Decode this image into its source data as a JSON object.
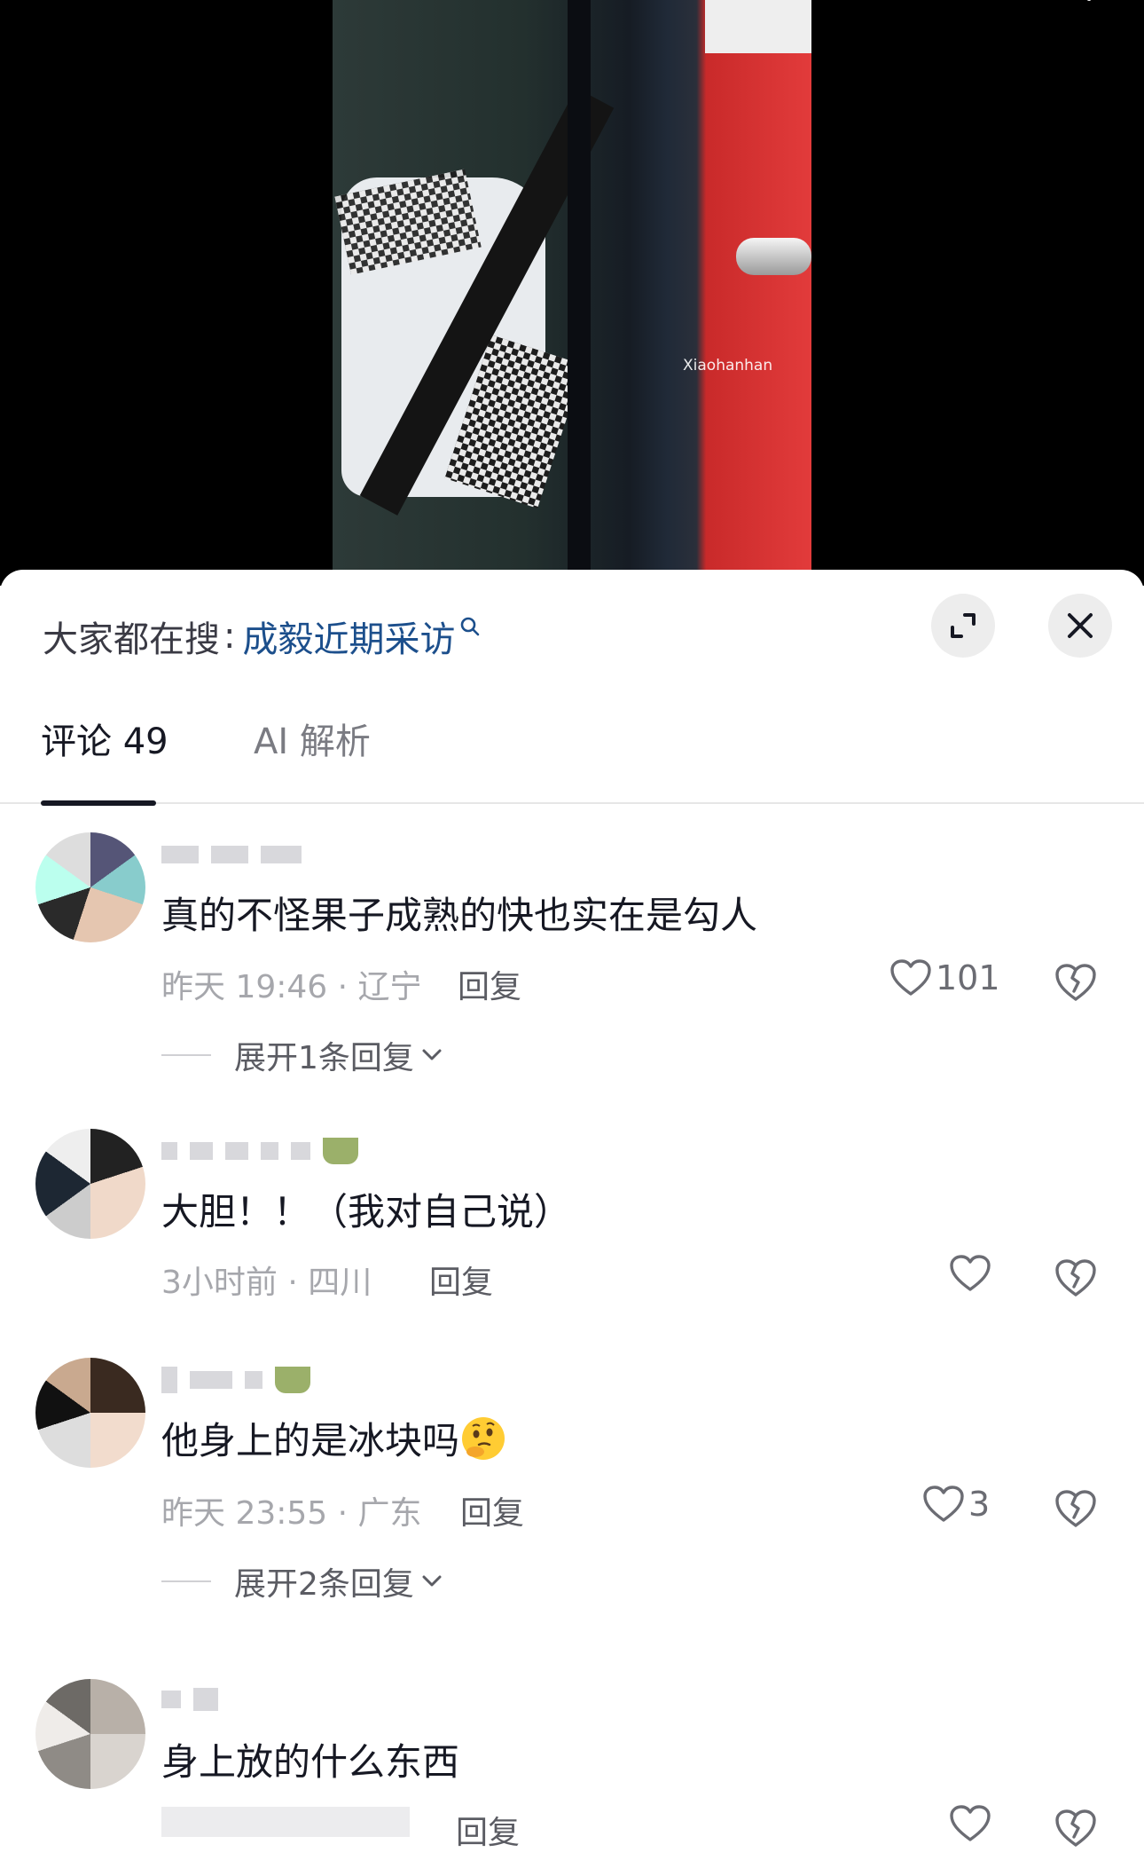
{
  "video": {
    "watermark": "Xiaohanhan"
  },
  "sheet": {
    "search_prefix": "大家都在搜",
    "search_separator": ":",
    "search_term": "成毅近期采访"
  },
  "tabs": {
    "comments_label": "评论 49",
    "ai_label": "AI 解析"
  },
  "comments": [
    {
      "text": "真的不怪果子成熟的快也实在是勾人",
      "meta": "昨天 19:46 · 辽宁",
      "reply_label": "回复",
      "likes": "101",
      "expand_label": "展开1条回复"
    },
    {
      "text": "大胆！！（我对自己说）",
      "meta": "3小时前 · 四川",
      "reply_label": "回复",
      "likes": ""
    },
    {
      "text": "他身上的是冰块吗",
      "emoji": "thinking-face-emoji",
      "meta": "昨天 23:55 · 广东",
      "reply_label": "回复",
      "likes": "3",
      "expand_label": "展开2条回复"
    },
    {
      "text": "身上放的什么东西",
      "meta": "",
      "reply_label": "回复",
      "likes": ""
    }
  ],
  "icons": {
    "search": "search-icon",
    "expand": "expand-fullscreen-icon",
    "close": "close-icon",
    "like": "heart-icon",
    "dislike": "broken-heart-icon",
    "chevron": "chevron-down-icon"
  },
  "colors": {
    "search_term": "#1c4f8c",
    "text_primary": "#161823",
    "text_secondary": "#a6a7ac"
  }
}
